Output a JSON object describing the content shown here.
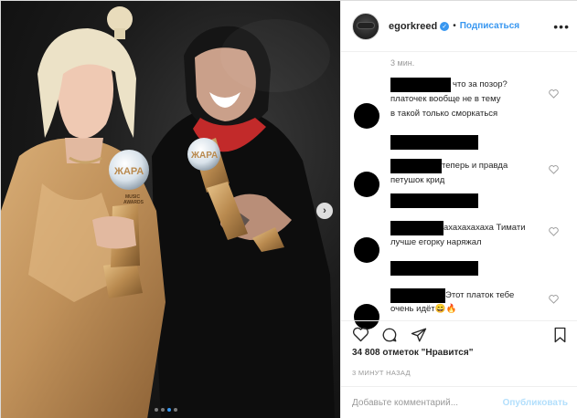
{
  "post": {
    "username": "egorkreed",
    "follow_label": "Подписаться",
    "separator": "•",
    "more_label": "•••",
    "time_top": "3 мин.",
    "likes": "34 808 отметок \"Нравится\"",
    "posted": "3 МИНУТ НАЗАД",
    "comment_placeholder": "Добавьте комментарий...",
    "publish_label": "Опубликовать",
    "photo_label": "MUSIC AWARDS"
  },
  "comments": [
    {
      "lines": [
        "что за позор?",
        "платочек вообще не в тему",
        "в такой только сморкаться"
      ]
    },
    {
      "lines": [
        "теперь и правда",
        "петушок крид"
      ]
    },
    {
      "lines": [
        "ахахахахаха Тимати",
        "лучше егорку наряжал"
      ]
    },
    {
      "lines": [
        "Этот платок тебе",
        "очень идёт😄🔥"
      ]
    }
  ],
  "icons": {
    "verified": "verified-badge-icon",
    "like": "heart-icon",
    "comment": "comment-icon",
    "share": "send-icon",
    "save": "bookmark-icon",
    "next": "chevron-right-icon"
  },
  "colors": {
    "accent": "#3897f0",
    "publish_disabled": "#b2dffc",
    "muted": "#999999",
    "text": "#262626"
  },
  "carousel": {
    "count": 4,
    "active": 3
  }
}
